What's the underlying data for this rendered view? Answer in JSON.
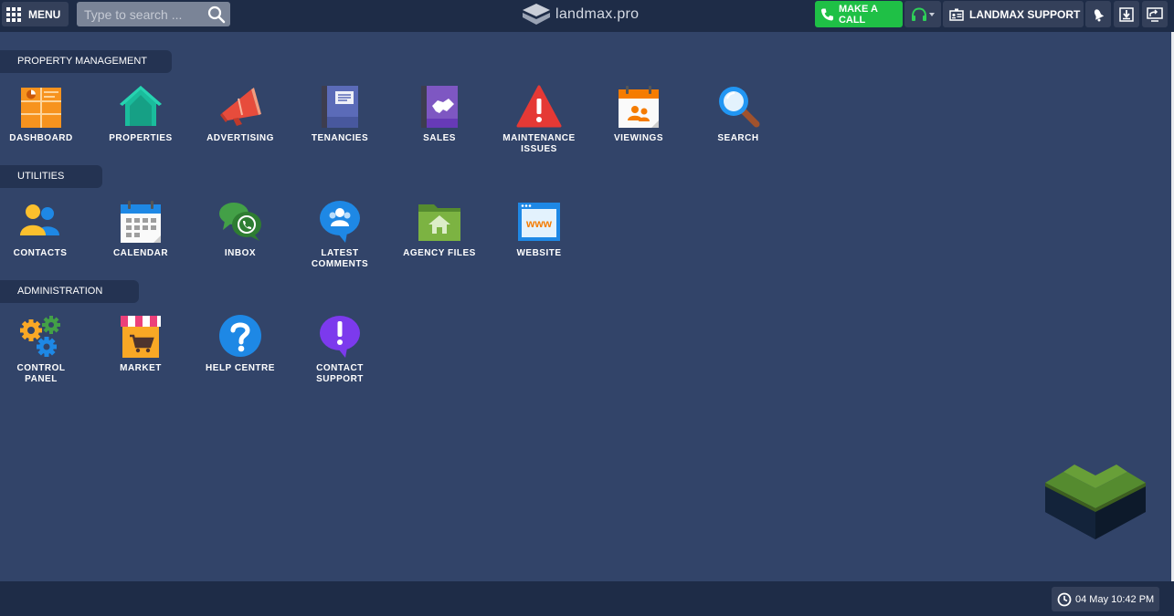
{
  "header": {
    "menu_label": "MENU",
    "search_placeholder": "Type to search ...",
    "brand": "landmax.pro",
    "call_label": "MAKE A CALL",
    "support_label": "LANDMAX SUPPORT"
  },
  "sections": [
    {
      "title": "PROPERTY MANAGEMENT",
      "items": [
        {
          "label": "DASHBOARD",
          "icon": "dashboard-icon"
        },
        {
          "label": "PROPERTIES",
          "icon": "house-icon"
        },
        {
          "label": "ADVERTISING",
          "icon": "megaphone-icon"
        },
        {
          "label": "TENANCIES",
          "icon": "binder-icon"
        },
        {
          "label": "SALES",
          "icon": "handshake-icon"
        },
        {
          "label": "MAINTENANCE ISSUES",
          "icon": "warning-icon"
        },
        {
          "label": "VIEWINGS",
          "icon": "calendar-people-icon"
        },
        {
          "label": "SEARCH",
          "icon": "magnifier-icon"
        }
      ]
    },
    {
      "title": "UTILITIES",
      "items": [
        {
          "label": "CONTACTS",
          "icon": "contacts-icon"
        },
        {
          "label": "CALENDAR",
          "icon": "calendar-icon"
        },
        {
          "label": "INBOX",
          "icon": "chat-phone-icon"
        },
        {
          "label": "LATEST COMMENTS",
          "icon": "comment-icon"
        },
        {
          "label": "AGENCY FILES",
          "icon": "folder-icon"
        },
        {
          "label": "WEBSITE",
          "icon": "www-icon"
        }
      ]
    },
    {
      "title": "ADMINISTRATION",
      "items": [
        {
          "label": "CONTROL PANEL",
          "icon": "gears-icon"
        },
        {
          "label": "MARKET",
          "icon": "market-icon"
        },
        {
          "label": "HELP CENTRE",
          "icon": "help-icon"
        },
        {
          "label": "CONTACT SUPPORT",
          "icon": "exclamation-bubble-icon"
        }
      ]
    }
  ],
  "footer": {
    "datetime": "04 May 10:42 PM"
  },
  "colors": {
    "background": "#324469",
    "topbar": "#1e2c47",
    "accent_green": "#1fc046"
  }
}
